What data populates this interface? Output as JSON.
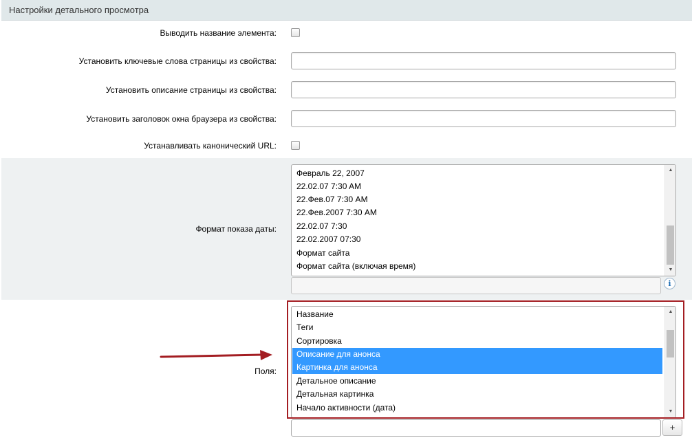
{
  "section": {
    "title": "Настройки детального просмотра"
  },
  "rows": {
    "show_name": {
      "label": "Выводить название элемента:"
    },
    "keywords": {
      "label": "Установить ключевые слова страницы из свойства:",
      "value": ""
    },
    "description": {
      "label": "Установить описание страницы из свойства:",
      "value": ""
    },
    "browser_title": {
      "label": "Установить заголовок окна браузера из свойства:",
      "value": ""
    },
    "canonical": {
      "label": "Устанавливать канонический URL:"
    }
  },
  "date_format": {
    "label": "Формат показа даты:",
    "options": [
      "Февраль 22, 2007",
      "22.02.07 7:30 AM",
      "22.Фев.07 7:30 AM",
      "22.Фев.2007 7:30 AM",
      "22.02.07 7:30",
      "22.02.2007 07:30",
      "Формат сайта",
      "Формат сайта (включая время)"
    ],
    "custom_value": "",
    "info_glyph": "i"
  },
  "fields": {
    "label": "Поля:",
    "options": [
      "Название",
      "Теги",
      "Сортировка",
      "Описание для анонса",
      "Картинка для анонса",
      "Детальное описание",
      "Детальная картинка",
      "Начало активности (дата)"
    ],
    "selected": [
      3,
      4
    ],
    "add_label": "+",
    "custom_value": ""
  },
  "colors": {
    "header_bg": "#e0e8ea",
    "band_bg": "#eef1f2",
    "selection": "#3399ff",
    "highlight_border": "#a31d22",
    "arrow": "#a31d22"
  },
  "icons": {
    "scroll_up": "scroll-up-arrow-icon",
    "scroll_down": "scroll-down-arrow-icon",
    "info": "info-icon",
    "annotation_arrow": "red-arrow-icon"
  }
}
